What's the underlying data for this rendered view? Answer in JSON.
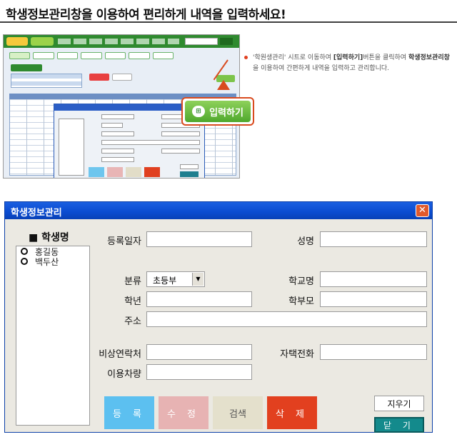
{
  "header": {
    "title": "학생정보관리창을 이용하여 편리하게 내역을 입력하세요!"
  },
  "callout": {
    "button_label": "입력하기",
    "explanation_pre": "'학원생관리' 시트로 이동하여 ",
    "explanation_bold1": "[입력하기]",
    "explanation_mid1": "버튼을 클릭하여 ",
    "explanation_bold2": "학생정보관리창",
    "explanation_post": "을 이용하여 간편하게 내역을 입력하고 관리합니다."
  },
  "dialog": {
    "title": "학생정보관리",
    "close_glyph": "✕",
    "list_header": "■ 학생명",
    "students": [
      "홍길동",
      "백두산"
    ],
    "labels": {
      "reg_date": "등록일자",
      "name": "성명",
      "category": "분류",
      "school": "학교명",
      "grade": "학년",
      "parent": "학부모",
      "address": "주소",
      "emergency": "비상연락처",
      "home_phone": "자택전화",
      "vehicle": "이용차량"
    },
    "category_value": "초등부",
    "buttons": {
      "register": "등 록",
      "modify": "수 정",
      "search": "검색",
      "delete": "삭 제",
      "clear": "지우기",
      "close": "닫 기"
    }
  },
  "colors": {
    "titlebar": "#0a4bd0",
    "register": "#5cc0f0",
    "modify": "#e7b3b3",
    "search": "#e4e0cc",
    "delete": "#e2401f",
    "close_btn": "#138a8c",
    "callout": "#4fa82d"
  }
}
